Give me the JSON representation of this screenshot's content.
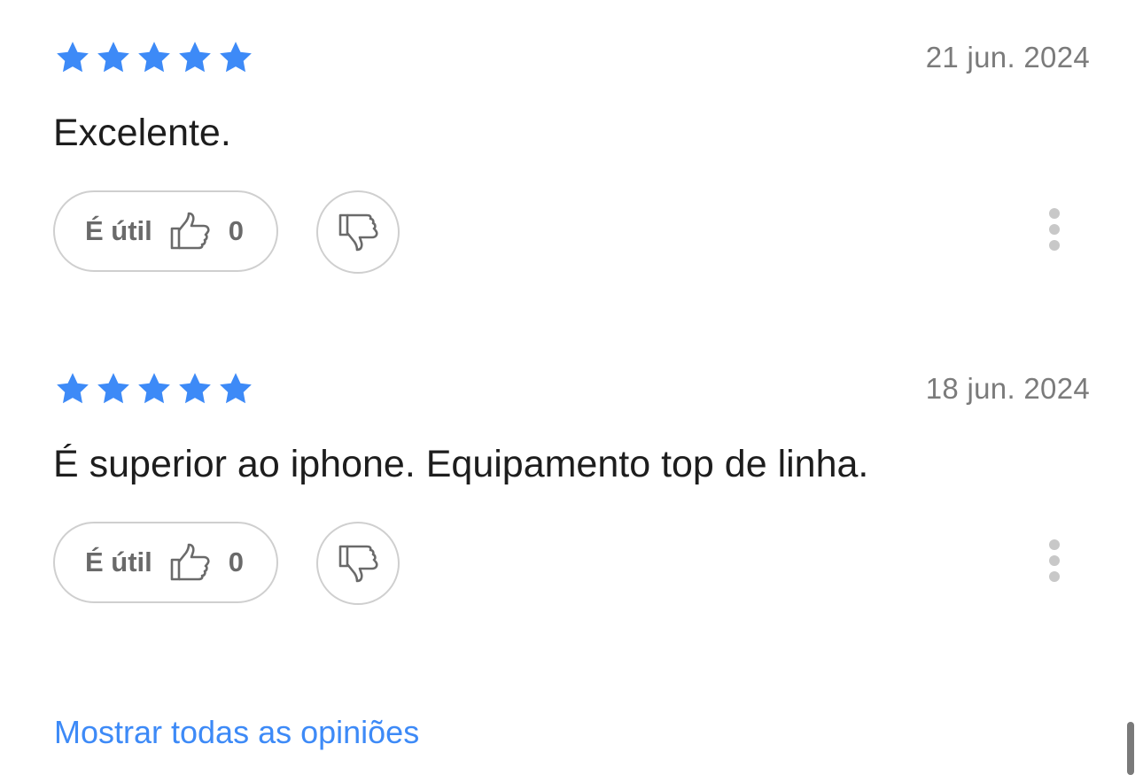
{
  "colors": {
    "star": "#3d8af7",
    "link": "#3d8af7",
    "date": "#7b7b7b",
    "button_border": "#cfcfcf"
  },
  "reviews": [
    {
      "rating": 5,
      "date": "21 jun. 2024",
      "text": "Excelente.",
      "useful_label": "É útil",
      "useful_count": "0",
      "icons": [
        "star-icon",
        "thumbs-up-icon",
        "thumbs-down-icon",
        "more-vertical-icon"
      ]
    },
    {
      "rating": 5,
      "date": "18 jun. 2024",
      "text": "É superior ao iphone. Equipamento top de linha.",
      "useful_label": "É útil",
      "useful_count": "0",
      "icons": [
        "star-icon",
        "thumbs-up-icon",
        "thumbs-down-icon",
        "more-vertical-icon"
      ]
    }
  ],
  "footer": {
    "show_all_label": "Mostrar todas as opiniões"
  }
}
